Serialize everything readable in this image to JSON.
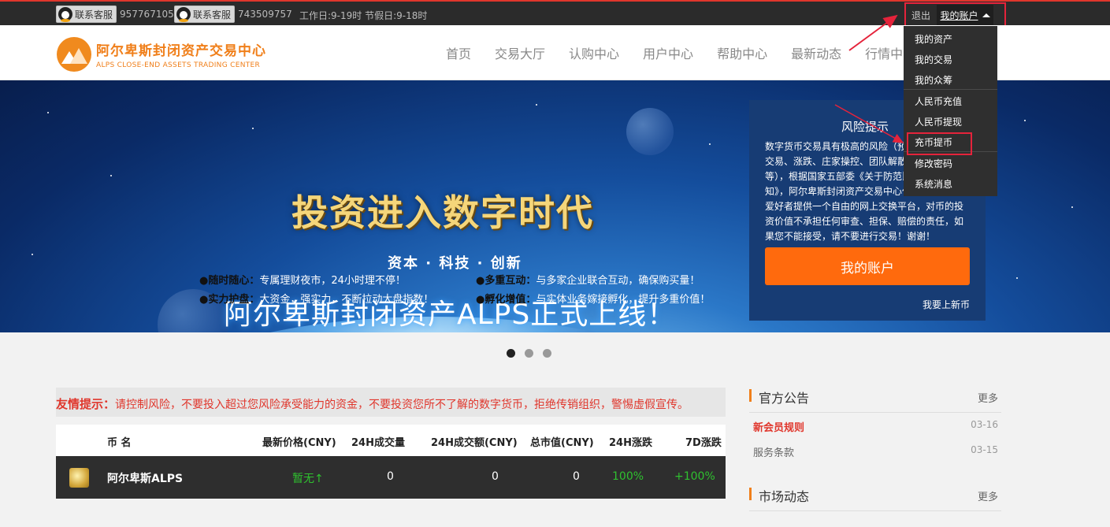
{
  "topbar": {
    "qq1_label": "联系客服",
    "qq1_number": "957767105",
    "qq2_label": "联系客服",
    "qq2_number": "743509757",
    "worktime": "工作日:9-19时 节假日:9-18时",
    "logout": "退出",
    "my_account": "我的账户"
  },
  "logo": {
    "cn": "阿尔卑斯封闭资产交易中心",
    "en": "ALPS CLOSE-END ASSETS TRADING CENTER"
  },
  "nav": [
    "首页",
    "交易大厅",
    "认购中心",
    "用户中心",
    "帮助中心",
    "最新动态",
    "行情中"
  ],
  "dropdown": [
    "我的资产",
    "我的交易",
    "我的众筹",
    "人民币充值",
    "人民币提现",
    "充币提币",
    "修改密码",
    "系统消息"
  ],
  "banner": {
    "slogan": "投资进入数字时代",
    "subslogan": "资本 · 科技 ·  创新",
    "launch": "阿尔卑斯封闭资产ALPS正式上线！",
    "features": [
      {
        "key": "●随时随心：",
        "text": "专属理财夜市，24小时理不停！"
      },
      {
        "key": "●多重互动：",
        "text": "与多家企业联合互动，确保购买量！"
      },
      {
        "key": "●实力护盘：",
        "text": "大资金，强实力，不断拉动大盘指数！"
      },
      {
        "key": "●孵化增值：",
        "text": "与实体业务嫁接孵化，提升多重价值！"
      }
    ]
  },
  "risk": {
    "title": "风险提示",
    "body": "数字货币交易具有极高的风险（预测性、24小时交易、涨跌、庄家操控、团队解散、技术缺陷等），根据国家五部委《关于防范比特币风险的通知》，阿尔卑斯封闭资产交易中心仅为数字货币的爱好者提供一个自由的网上交换平台，对币的投资价值不承担任何审查、担保、赔偿的责任，如果您不能接受，请不要进行交易！谢谢！",
    "button": "我的账户",
    "link": "我要上新币"
  },
  "tip": {
    "label": "友情提示：",
    "text": "请控制风险，不要投入超过您风险承受能力的资金，不要投资您所不了解的数字货币，拒绝传销组织，警惕虚假宣传。"
  },
  "table": {
    "headers": [
      "币 名",
      "最新价格(CNY)",
      "24H成交量",
      "24H成交额(CNY)",
      "总市值(CNY)",
      "24H涨跌",
      "7D涨跌"
    ],
    "row": {
      "name": "阿尔卑斯ALPS",
      "price": "暂无↑",
      "volume": "0",
      "amount": "0",
      "cap": "0",
      "change24": "100%",
      "change7d": "+100%"
    }
  },
  "notice": {
    "title": "官方公告",
    "more": "更多",
    "items": [
      {
        "label": "新会员规则",
        "date": "03-16"
      },
      {
        "label": "服务条款",
        "date": "03-15"
      }
    ]
  },
  "market": {
    "title": "市场动态",
    "more": "更多"
  },
  "colors": {
    "accent": "#f07f1a",
    "highlight_box": "#e5233b",
    "green": "#2fc12f",
    "orange_button": "#ff6a0d"
  }
}
